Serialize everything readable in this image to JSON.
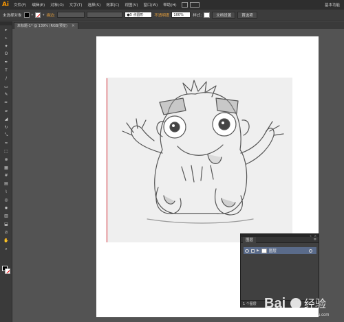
{
  "app": {
    "logo": "Ai",
    "accent": "#ff9a00"
  },
  "menu": {
    "items": [
      "文件(F)",
      "编辑(E)",
      "对象(O)",
      "文字(T)",
      "选择(S)",
      "效果(C)",
      "视图(V)",
      "窗口(W)",
      "帮助(H)"
    ],
    "workspace": "基本功能"
  },
  "control": {
    "selection_status": "未选择对象",
    "stroke_link": "描边:",
    "brush_label": "5 点圆形",
    "opacity_link": "不透明度",
    "opacity_value": "100%",
    "style_label": "样式:",
    "doc_setup_button": "文档设置",
    "preferences_button": "首选项"
  },
  "document": {
    "tab_title": "未标题-1* @ 139% (RGB/预览)"
  },
  "layers_panel": {
    "tab_label": "图层",
    "layers": [
      {
        "name": "图层"
      }
    ],
    "layer_count": "1 个图层"
  },
  "watermark": {
    "text": "Bai 经验",
    "sub": "jingyan.baidu.com"
  },
  "icons": {
    "tools": [
      "selection-tool-icon",
      "direct-selection-tool-icon",
      "magic-wand-icon",
      "lasso-icon",
      "pen-tool-icon",
      "type-tool-icon",
      "line-tool-icon",
      "rectangle-tool-icon",
      "paintbrush-icon",
      "pencil-icon",
      "blob-brush-icon",
      "eraser-icon",
      "rotate-icon",
      "scale-icon",
      "width-tool-icon",
      "free-transform-icon",
      "shape-builder-icon",
      "perspective-grid-icon",
      "mesh-icon",
      "gradient-icon",
      "eyedropper-icon",
      "blend-icon",
      "symbol-sprayer-icon",
      "column-graph-icon",
      "artboard-tool-icon",
      "slice-tool-icon",
      "hand-tool-icon",
      "zoom-tool-icon"
    ]
  }
}
